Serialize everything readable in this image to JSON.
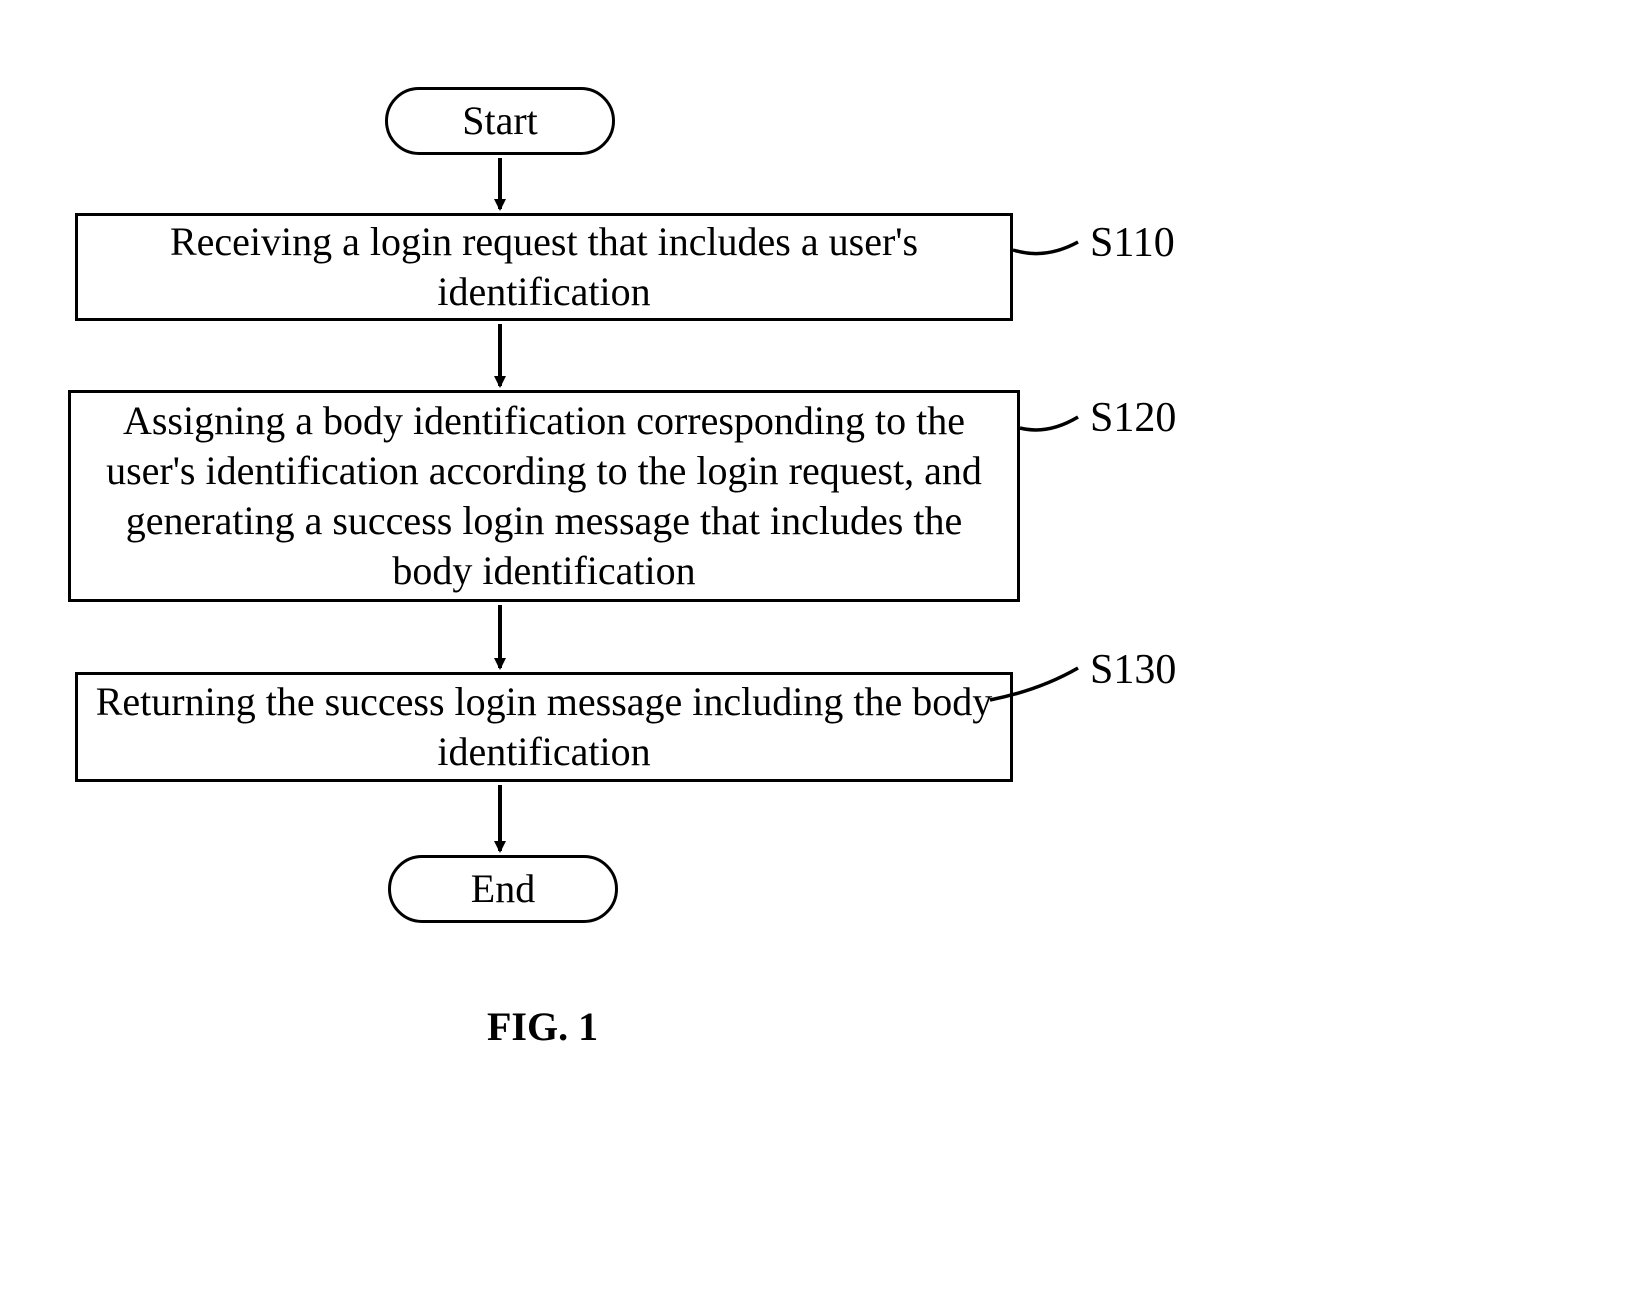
{
  "flowchart": {
    "start_label": "Start",
    "end_label": "End",
    "steps": [
      {
        "id": "S110",
        "text": "Receiving a login request that includes a user's identification"
      },
      {
        "id": "S120",
        "text": "Assigning a body identification corresponding to the user's identification according to the login request, and generating a success login message that includes the body identification"
      },
      {
        "id": "S130",
        "text": "Returning the success login message including the body identification"
      }
    ]
  },
  "caption": "FIG. 1"
}
